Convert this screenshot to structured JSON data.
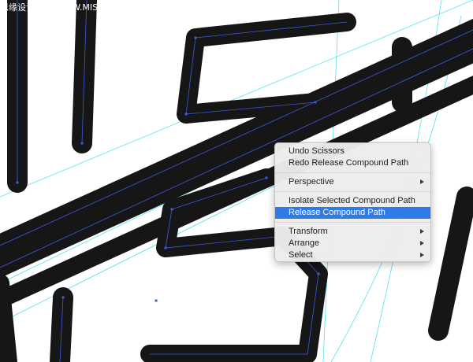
{
  "watermark": {
    "text": "思缘设计论坛 WWW.MISSYUAN.COM"
  },
  "context_menu": {
    "undo_label": "Undo Scissors",
    "redo_label": "Redo Release Compound Path",
    "perspective_label": "Perspective",
    "isolate_label": "Isolate Selected Compound Path",
    "release_label": "Release Compound Path",
    "transform_label": "Transform",
    "arrange_label": "Arrange",
    "select_label": "Select",
    "highlighted_item": "Release Compound Path"
  },
  "colors": {
    "stroke": "#161616",
    "path_outline": "#3d5bd9",
    "anchor": "#3d5bd9",
    "guide": "#57e0f0",
    "highlight": "#2e7ae6"
  }
}
